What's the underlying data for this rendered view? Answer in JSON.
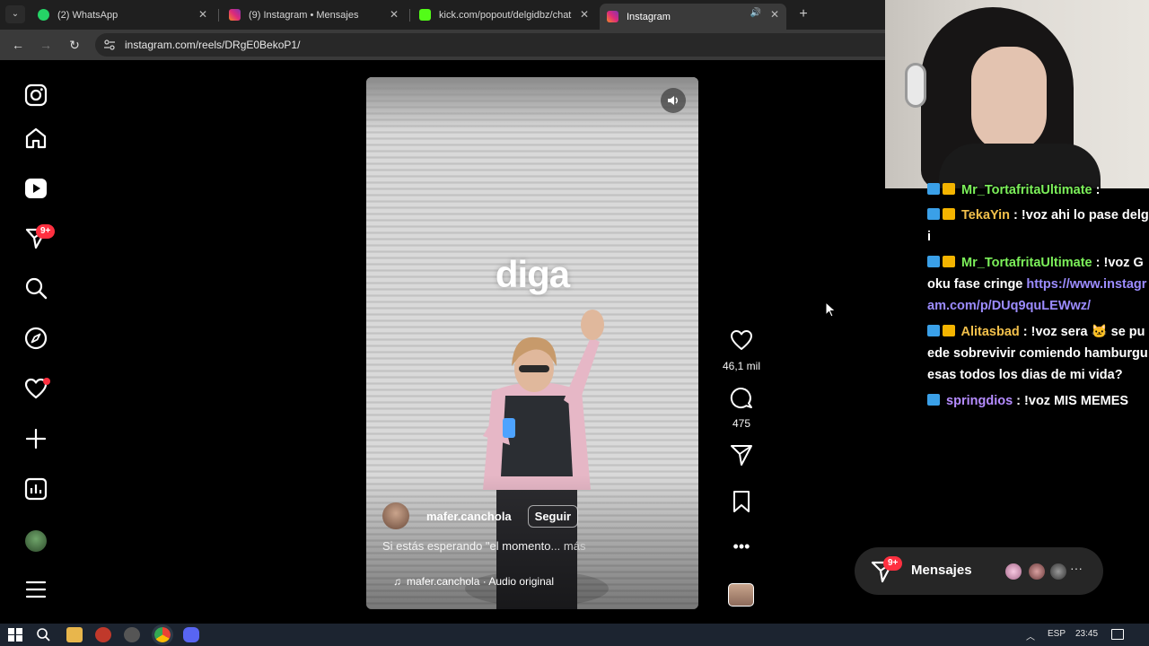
{
  "browser": {
    "tabs": [
      {
        "title": "(2) WhatsApp",
        "icon": "whatsapp-icon",
        "color": "#25d366"
      },
      {
        "title": "(9) Instagram • Mensajes",
        "icon": "instagram-icon",
        "color": "#e1306c"
      },
      {
        "title": "kick.com/popout/delgidbz/chat",
        "icon": "kick-icon",
        "color": "#53fc18"
      },
      {
        "title": "Instagram",
        "icon": "instagram-icon",
        "color": "#e1306c",
        "active": true,
        "audio": true
      }
    ],
    "url": "instagram.com/reels/DRgE0BekoP1/"
  },
  "sidebar": {
    "notification_badge": "9+",
    "items": [
      "instagram-logo-icon",
      "home-icon",
      "reels-icon",
      "messages-icon",
      "search-icon",
      "explore-icon",
      "notifications-icon",
      "create-icon",
      "dashboard-icon",
      "profile-avatar",
      "more-menu-icon"
    ]
  },
  "reel": {
    "overlay_text": "diga",
    "author": "mafer.canchola",
    "follow_label": "Seguir",
    "caption": "Si estás esperando \"el momento",
    "caption_more": "... más",
    "audio": "mafer.canchola · Audio original"
  },
  "actions": {
    "likes": "46,1 mil",
    "comments": "475"
  },
  "messages_pill": {
    "label": "Mensajes",
    "badge": "9+"
  },
  "chat": {
    "messages": [
      {
        "user": "Mr_TortafritaUltimate",
        "color": "green",
        "text": ""
      },
      {
        "user": "TekaYin",
        "color": "yellow",
        "text": "!voz ahi lo pase delgi"
      },
      {
        "user": "Mr_TortafritaUltimate",
        "color": "green",
        "text": "!voz Goku fase cringe",
        "link": "https://www.instagram.com/p/DUq9quLEWwz/"
      },
      {
        "user": "Alitasbad",
        "color": "yellow",
        "text": "!voz sera 🐱 se puede sobrevivir comiendo hamburguesas todos los dias de mi vida?"
      },
      {
        "user": "springdios",
        "color": "purple",
        "text": "!voz MIS MEMES"
      }
    ]
  },
  "taskbar": {
    "lang": "ESP",
    "time": "23:45"
  }
}
